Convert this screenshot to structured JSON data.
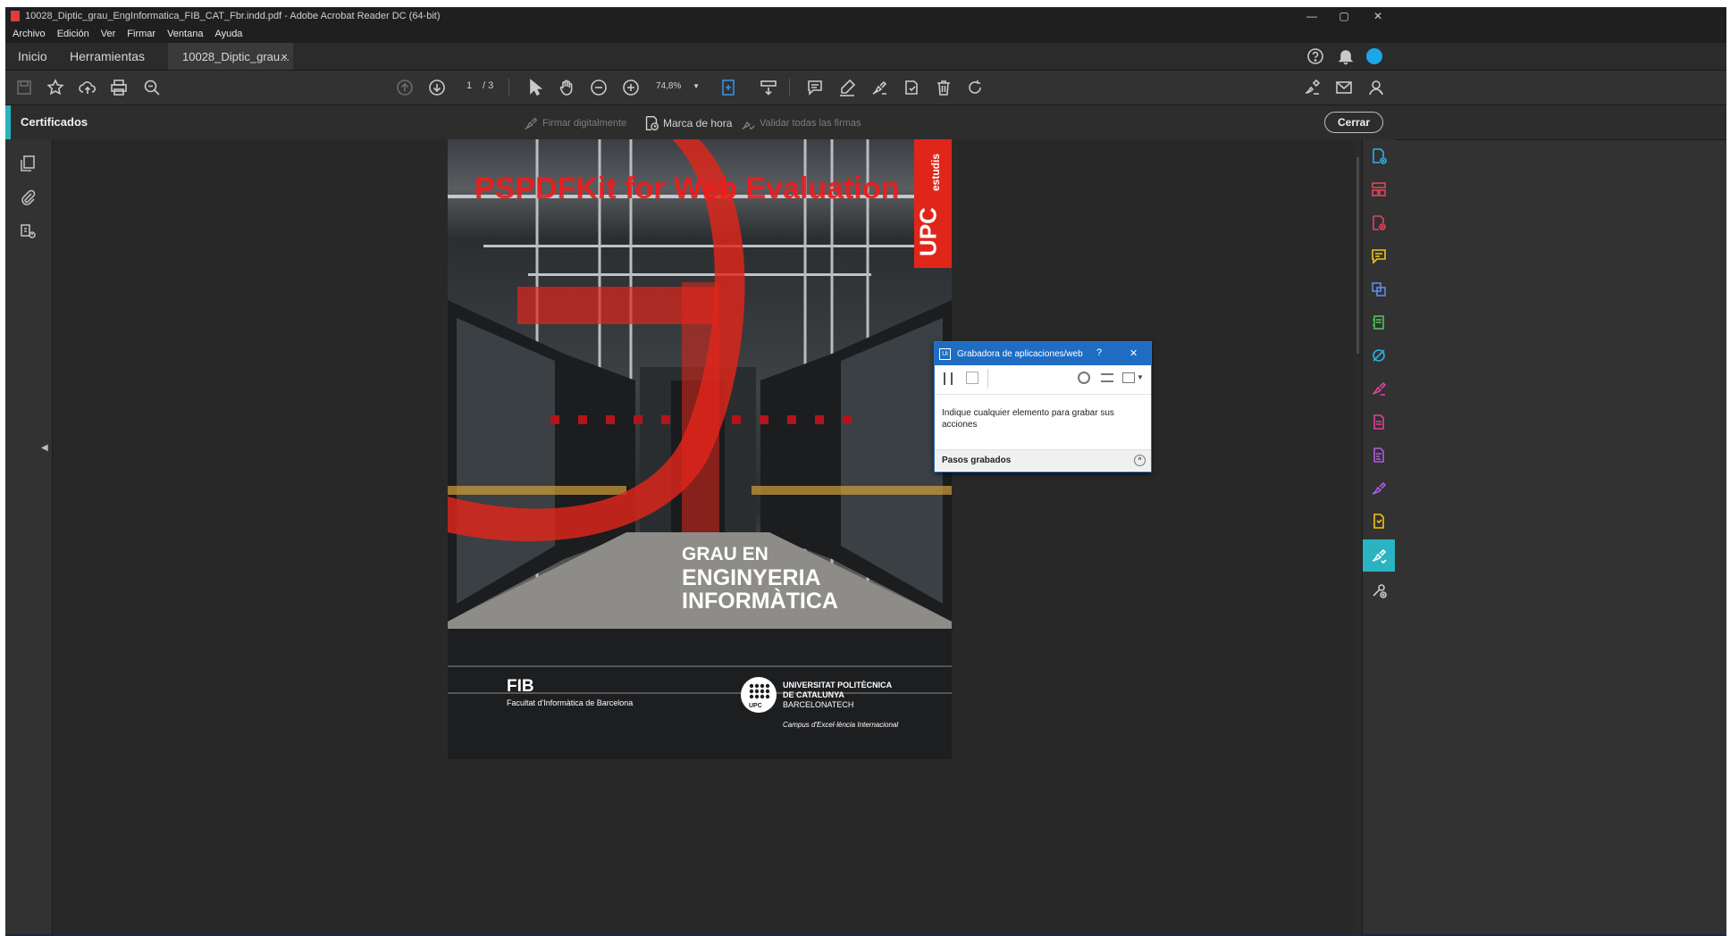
{
  "window": {
    "title": "10028_Diptic_grau_EngInformatica_FIB_CAT_Fbr.indd.pdf - Adobe Acrobat Reader DC (64-bit)",
    "controls": [
      "—",
      "▢",
      "✕"
    ]
  },
  "menu": [
    "Archivo",
    "Edición",
    "Ver",
    "Firmar",
    "Ventana",
    "Ayuda"
  ],
  "tabs": {
    "home": "Inicio",
    "tools": "Herramientas",
    "document": "10028_Diptic_grau...",
    "close": "×"
  },
  "toolbar": {
    "page_current": "1",
    "page_total": "/  3",
    "zoom": "74,8%"
  },
  "certificates": {
    "title": "Certificados",
    "sign_digitally": "Firmar digitalmente",
    "timestamp": "Marca de hora",
    "validate_all": "Validar todas las firmas",
    "close_button": "Cerrar"
  },
  "page": {
    "watermark": "PSPDFKit for Web Evaluation",
    "upc_badge": "UPC",
    "estudis": "estudis",
    "heading_line1": "GRAU EN",
    "heading_line2": "ENGINYERIA",
    "heading_line3": "INFORMÀTICA",
    "fib": "FIB",
    "fib_full": "Facultat d'Informàtica de Barcelona",
    "upc_logo_text": "UPC",
    "univ_line1": "UNIVERSITAT POLITÈCNICA",
    "univ_line2": "DE CATALUNYA",
    "univ_line3": "BARCELONATECH",
    "campus": "Campus d'Excel·lència Internacional"
  },
  "recorder": {
    "title": "Grabadora de aplicaciones/web",
    "help": "?",
    "close": "✕",
    "instruction": "Indique cualquier elemento para grabar sus acciones",
    "steps": "Pasos grabados"
  },
  "colors": {
    "accent": "#2ab3c0",
    "upc_red": "#e0261b",
    "recorder_blue": "#1f6dc2"
  }
}
